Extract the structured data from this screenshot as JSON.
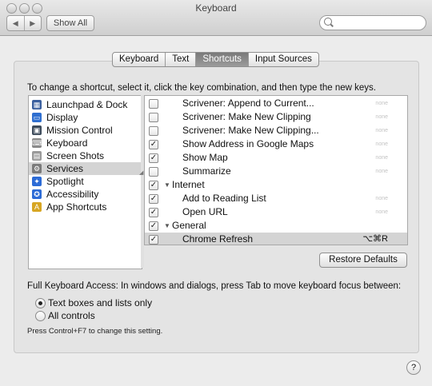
{
  "window": {
    "title": "Keyboard"
  },
  "toolbar": {
    "back": "◀",
    "forward": "▶",
    "show_all": "Show All",
    "search_placeholder": ""
  },
  "tabs": [
    {
      "label": "Keyboard",
      "active": false
    },
    {
      "label": "Text",
      "active": false
    },
    {
      "label": "Shortcuts",
      "active": true
    },
    {
      "label": "Input Sources",
      "active": false
    }
  ],
  "instruction": "To change a shortcut, select it, click the key combination, and then type the new keys.",
  "categories": [
    {
      "label": "Launchpad & Dock",
      "icon": "launchpad-icon",
      "color": "#3a5f9e",
      "glyph": "▦"
    },
    {
      "label": "Display",
      "icon": "display-icon",
      "color": "#2f6fd0",
      "glyph": "▭"
    },
    {
      "label": "Mission Control",
      "icon": "mission-control-icon",
      "color": "#3c4a5a",
      "glyph": "▣"
    },
    {
      "label": "Keyboard",
      "icon": "keyboard-icon",
      "color": "#8a8a8a",
      "glyph": "⌨"
    },
    {
      "label": "Screen Shots",
      "icon": "screenshot-icon",
      "color": "#9a9a9a",
      "glyph": "▤"
    },
    {
      "label": "Services",
      "icon": "services-icon",
      "color": "#7b7b7b",
      "glyph": "⚙",
      "selected": true
    },
    {
      "label": "Spotlight",
      "icon": "spotlight-icon",
      "color": "#2c6bd6",
      "glyph": "✦"
    },
    {
      "label": "Accessibility",
      "icon": "accessibility-icon",
      "color": "#2c6bd6",
      "glyph": "✪"
    },
    {
      "label": "App Shortcuts",
      "icon": "app-shortcuts-icon",
      "color": "#d7a623",
      "glyph": "A"
    }
  ],
  "shortcuts": [
    {
      "kind": "item",
      "checked": false,
      "label": "Scrivener: Append to Current...",
      "key": "none"
    },
    {
      "kind": "item",
      "checked": false,
      "label": "Scrivener: Make New Clipping",
      "key": "none"
    },
    {
      "kind": "item",
      "checked": false,
      "label": "Scrivener: Make New Clipping...",
      "key": "none"
    },
    {
      "kind": "item",
      "checked": true,
      "label": "Show Address in Google Maps",
      "key": "none"
    },
    {
      "kind": "item",
      "checked": true,
      "label": "Show Map",
      "key": "none"
    },
    {
      "kind": "item",
      "checked": false,
      "label": "Summarize",
      "key": "none"
    },
    {
      "kind": "group",
      "checked": true,
      "label": "Internet",
      "key": ""
    },
    {
      "kind": "item",
      "checked": true,
      "label": "Add to Reading List",
      "key": "none"
    },
    {
      "kind": "item",
      "checked": true,
      "label": "Open URL",
      "key": "none"
    },
    {
      "kind": "group",
      "checked": true,
      "label": "General",
      "key": ""
    },
    {
      "kind": "item",
      "checked": true,
      "label": "Chrome Refresh",
      "key": "⌥⌘R",
      "selected": true
    }
  ],
  "restore_button": "Restore Defaults",
  "full_keyboard_access": {
    "label": "Full Keyboard Access: In windows and dialogs, press Tab to move keyboard focus between:",
    "options": [
      {
        "label": "Text boxes and lists only",
        "selected": true
      },
      {
        "label": "All controls",
        "selected": false
      }
    ],
    "note": "Press Control+F7 to change this setting."
  },
  "help": "?",
  "colors": {
    "selection": "#d4d4d4",
    "active_tab": "#8a8a8a"
  }
}
